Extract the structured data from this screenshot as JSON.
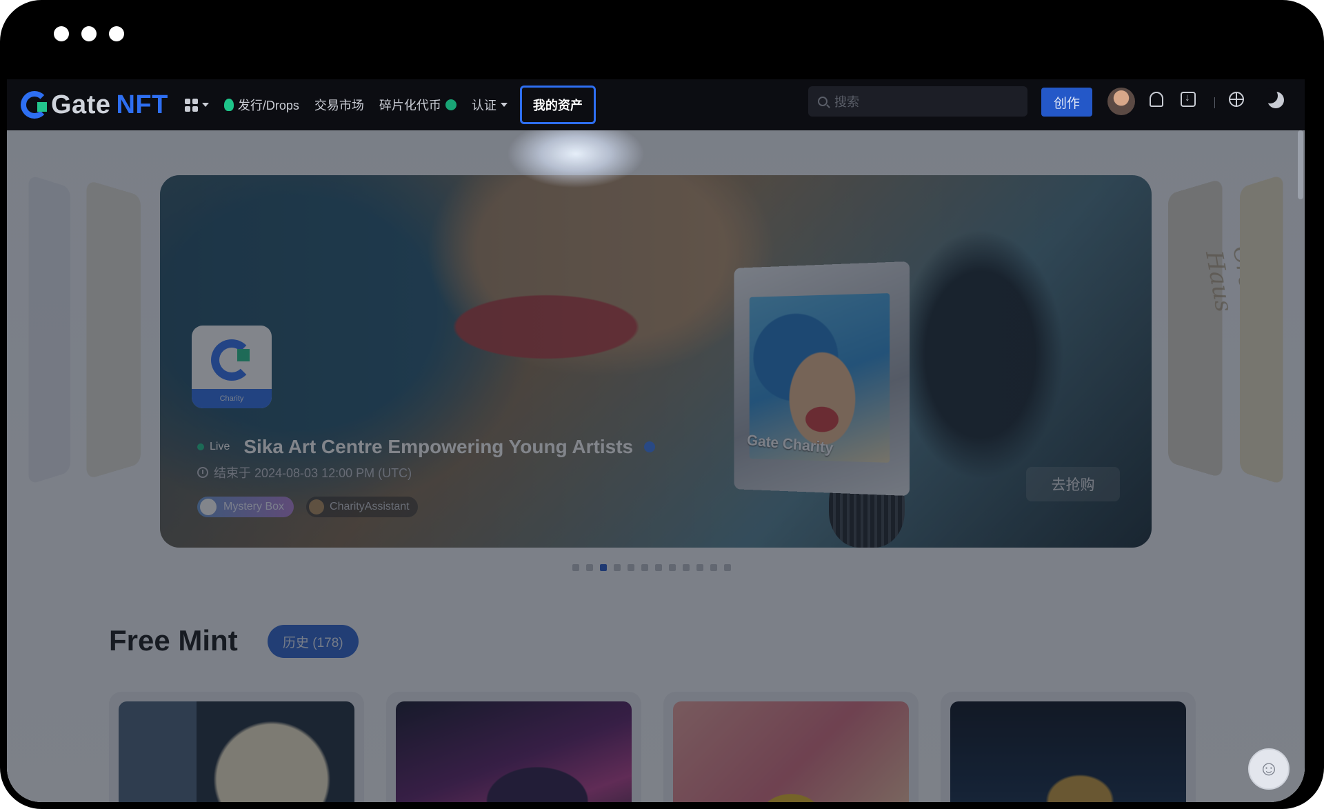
{
  "window": {
    "traffic_lights": [
      "dot",
      "dot",
      "dot"
    ]
  },
  "nav": {
    "logo_text": "Gate",
    "logo_suffix": "NFT",
    "apps_icon": "grid-icon",
    "items": [
      {
        "label": "发行/Drops",
        "icon": "flame-icon"
      },
      {
        "label": "交易市场"
      },
      {
        "label": "碎片化代币",
        "icon": "coin-icon"
      },
      {
        "label": "认证",
        "has_dropdown": true
      }
    ],
    "my_assets": "我的资产",
    "search_placeholder": "搜索",
    "create_label": "创作",
    "icons": [
      "bell-icon",
      "download-icon",
      "globe-icon",
      "moon-icon"
    ]
  },
  "banner": {
    "collection_logo_caption": "Charity",
    "status": "Live",
    "title": "Sika Art Centre Empowering Young Artists",
    "ended_text": "结束于 2024-08-03 12:00 PM (UTC)",
    "tag_type": "Mystery Box",
    "creator": "CharityAssistant",
    "artwork_label": "Gate Charity",
    "cta": "去抢购",
    "side_text": "Creative Haus"
  },
  "pager": {
    "total": 12,
    "active_index": 2
  },
  "free_mint": {
    "title": "Free Mint",
    "history_label": "历史 (178)"
  },
  "colors": {
    "accent": "#2e6ff2",
    "nav_bg": "#0c0d12",
    "live": "#1ec489",
    "highlight_border": "#2e6ff2"
  }
}
